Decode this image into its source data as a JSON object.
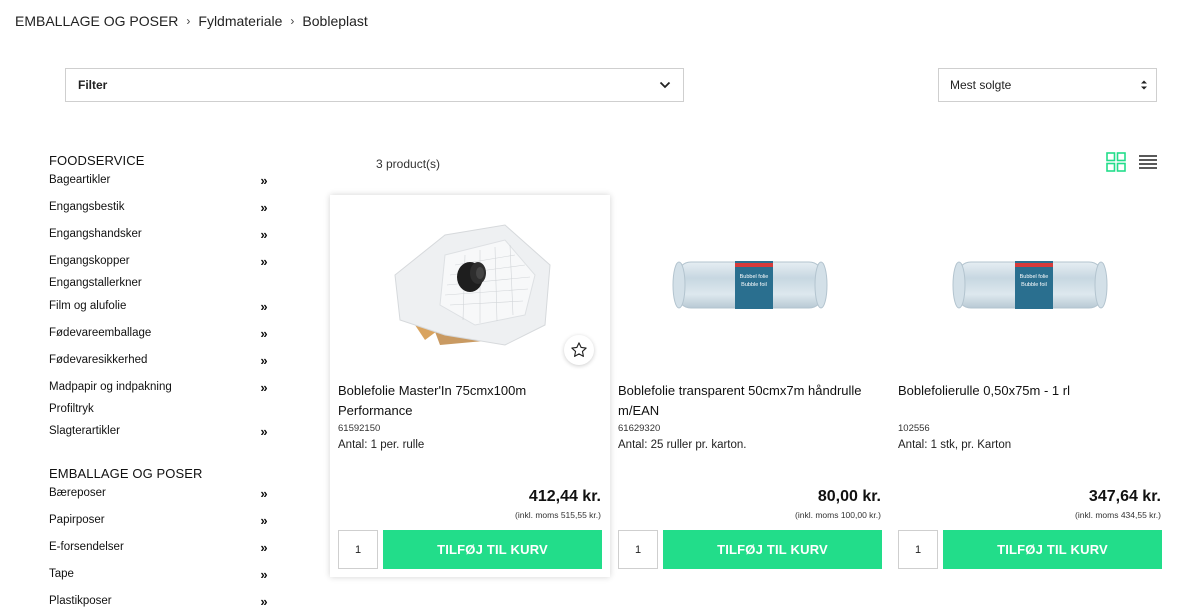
{
  "breadcrumb": {
    "items": [
      "EMBALLAGE OG POSER",
      "Fyldmateriale",
      "Bobleplast"
    ],
    "separator": "›"
  },
  "filter": {
    "label": "Filter"
  },
  "sort": {
    "selected": "Mest solgte"
  },
  "sidebar": {
    "groups": [
      {
        "heading": "FOODSERVICE",
        "items": [
          {
            "label": "Bageartikler",
            "expandable": true
          },
          {
            "label": "Engangsbestik",
            "expandable": true
          },
          {
            "label": "Engangshandsker",
            "expandable": true
          },
          {
            "label": "Engangskopper",
            "expandable": true
          },
          {
            "label": "Engangstallerkner",
            "expandable": false
          },
          {
            "label": "Film og alufolie",
            "expandable": true
          },
          {
            "label": "Fødevareemballage",
            "expandable": true
          },
          {
            "label": "Fødevaresikkerhed",
            "expandable": true
          },
          {
            "label": "Madpapir og indpakning",
            "expandable": true
          },
          {
            "label": "Profiltryk",
            "expandable": false
          },
          {
            "label": "Slagterartikler",
            "expandable": true
          }
        ]
      },
      {
        "heading": "EMBALLAGE OG POSER",
        "items": [
          {
            "label": "Bæreposer",
            "expandable": true
          },
          {
            "label": "Papirposer",
            "expandable": true
          },
          {
            "label": "E-forsendelser",
            "expandable": true
          },
          {
            "label": "Tape",
            "expandable": true
          },
          {
            "label": "Plastikposer",
            "expandable": true
          }
        ]
      }
    ],
    "chevron": "»"
  },
  "results": {
    "count_text": "3 product(s)"
  },
  "products": [
    {
      "title": "Boblefolie Master'In 75cmx100m Performance",
      "sku": "61592150",
      "quantity_info": "Antal: 1 per. rulle",
      "price": "412,44 kr.",
      "vat_note": "(inkl. moms 515,55 kr.)",
      "qty_value": "1",
      "button_label": "TILFØJ TIL KURV",
      "image": "bubble-wrap-box",
      "favorite": true
    },
    {
      "title": "Boblefolie transparent 50cmx7m håndrulle m/EAN",
      "sku": "61629320",
      "quantity_info": "Antal: 25 ruller pr. karton.",
      "price": "80,00 kr.",
      "vat_note": "(inkl. moms 100,00 kr.)",
      "qty_value": "1",
      "button_label": "TILFØJ TIL KURV",
      "image": "bubble-roll",
      "roll_label": [
        "Bubbel folie",
        "Bubble foil"
      ]
    },
    {
      "title": "Boblefolierulle 0,50x75m - 1 rl",
      "sku": "102556",
      "quantity_info": "Antal: 1 stk, pr. Karton",
      "price": "347,64 kr.",
      "vat_note": "(inkl. moms 434,55 kr.)",
      "qty_value": "1",
      "button_label": "TILFØJ TIL KURV",
      "image": "bubble-roll",
      "roll_label": [
        "Bubbel folie",
        "Bubble foil"
      ]
    }
  ],
  "colors": {
    "accent": "#22dd8a",
    "border": "#cfcfcf",
    "roll_band": "#2a6f8f"
  }
}
